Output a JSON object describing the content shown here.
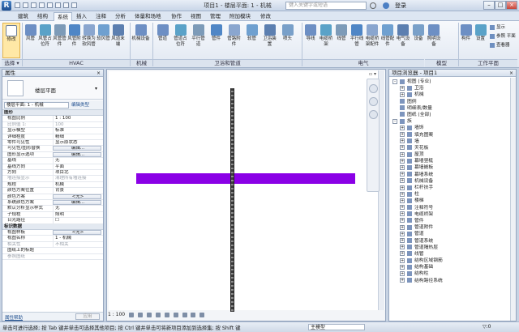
{
  "app": {
    "title": "项目1 - 楼层平面: 1 - 机械",
    "search_placeholder": "键入关键字或短语",
    "login": "登录",
    "brand_letter": "R"
  },
  "menu": {
    "tabs": [
      "建筑",
      "结构",
      "系统",
      "插入",
      "注释",
      "分析",
      "体量和场地",
      "协作",
      "视图",
      "管理",
      "附加模块",
      "修改"
    ],
    "active_index": 2
  },
  "ribbon": {
    "modify": "修改",
    "hvac_buttons": [
      "风管",
      "风管占位符",
      "风管管件",
      "风管附件",
      "转换为软风管",
      "软风管",
      "风道末端"
    ],
    "mech_buttons": [
      "机械设备"
    ],
    "plumbing_buttons": [
      "管道",
      "管道占位符",
      "平行管道",
      "管件",
      "管路附件",
      "软管",
      "卫浴装置",
      "喷头"
    ],
    "elec_buttons": [
      "导线",
      "电缆桥架",
      "线管",
      "平行线管",
      "电缆桥架配件",
      "线管配件",
      "电气设备",
      "设备",
      "照明设备"
    ],
    "workplane_buttons": [
      "构件",
      "设置"
    ],
    "workplane_small": [
      "显示",
      "参照 平面",
      "查看器"
    ],
    "panels": {
      "select": "选择 ▾",
      "hvac": "HVAC",
      "mech": "机械",
      "plumbing": "卫浴和管道",
      "elec": "电气",
      "model": "模型",
      "workplane": "工作平面"
    }
  },
  "properties": {
    "title": "属性",
    "type_name": "楼层平面",
    "selector": "楼层平面: 1 - 机械",
    "edit_type": "编辑类型",
    "groups": [
      "图形",
      "标识数据"
    ],
    "graphics_rows": [
      {
        "k": "视图比例",
        "v": "1 : 100"
      },
      {
        "k": "比例值 1:",
        "v": "100",
        "grey": true
      },
      {
        "k": "显示模型",
        "v": "标准"
      },
      {
        "k": "详细程度",
        "v": "精细"
      },
      {
        "k": "零件可见性",
        "v": "显示原状态"
      },
      {
        "k": "可见性/图形替换",
        "v": "编辑...",
        "btn": true
      },
      {
        "k": "图形显示选项",
        "v": "编辑...",
        "btn": true
      },
      {
        "k": "基线",
        "v": "无"
      },
      {
        "k": "基线方向",
        "v": "平面"
      },
      {
        "k": "方向",
        "v": "项目北"
      },
      {
        "k": "墙连接显示",
        "v": "清理所有墙连接",
        "grey": true
      },
      {
        "k": "规程",
        "v": "机械"
      },
      {
        "k": "颜色方案位置",
        "v": "背景"
      },
      {
        "k": "颜色方案",
        "v": "<无>",
        "btn": true
      },
      {
        "k": "系统颜色方案",
        "v": "编辑...",
        "btn": true
      },
      {
        "k": "默认分析显示样式",
        "v": "无"
      },
      {
        "k": "子规程",
        "v": "照明"
      },
      {
        "k": "日光路径",
        "v": "☐"
      }
    ],
    "identity_rows": [
      {
        "k": "视图样板",
        "v": "<无>",
        "btn": true
      },
      {
        "k": "视图名称",
        "v": "1 - 机械"
      },
      {
        "k": "相关性",
        "v": "不相关",
        "grey": true
      },
      {
        "k": "图纸上的标题",
        "v": ""
      },
      {
        "k": "参照图纸",
        "v": "",
        "grey": true
      }
    ],
    "help": "属性帮助",
    "apply": "应用"
  },
  "canvas": {
    "scale": "1 : 100",
    "nav_top": "▫ ▾"
  },
  "browser": {
    "title": "项目浏览器 - 项目1",
    "items": [
      {
        "t": "视图 (专业)",
        "lvl": 0,
        "exp": "-"
      },
      {
        "t": "卫浴",
        "lvl": 1,
        "exp": "+"
      },
      {
        "t": "机械",
        "lvl": 1,
        "exp": "+"
      },
      {
        "t": "图例",
        "lvl": 0,
        "exp": ""
      },
      {
        "t": "明细表/数量",
        "lvl": 0,
        "exp": ""
      },
      {
        "t": "图纸 (全部)",
        "lvl": 0,
        "exp": ""
      },
      {
        "t": "族",
        "lvl": 0,
        "exp": "-"
      },
      {
        "t": "墙饰",
        "lvl": 1,
        "exp": "+"
      },
      {
        "t": "填充图案",
        "lvl": 1,
        "exp": "+"
      },
      {
        "t": "墙",
        "lvl": 1,
        "exp": "+"
      },
      {
        "t": "天花板",
        "lvl": 1,
        "exp": "+"
      },
      {
        "t": "屋顶",
        "lvl": 1,
        "exp": "+"
      },
      {
        "t": "幕墙竖梃",
        "lvl": 1,
        "exp": "+"
      },
      {
        "t": "幕墙嵌板",
        "lvl": 1,
        "exp": "+"
      },
      {
        "t": "幕墙系统",
        "lvl": 1,
        "exp": "+"
      },
      {
        "t": "机械设备",
        "lvl": 1,
        "exp": "+"
      },
      {
        "t": "栏杆扶手",
        "lvl": 1,
        "exp": "+"
      },
      {
        "t": "柱",
        "lvl": 1,
        "exp": "+"
      },
      {
        "t": "楼梯",
        "lvl": 1,
        "exp": "+"
      },
      {
        "t": "注释符号",
        "lvl": 1,
        "exp": "+"
      },
      {
        "t": "电缆桥架",
        "lvl": 1,
        "exp": "+"
      },
      {
        "t": "管件",
        "lvl": 1,
        "exp": "+"
      },
      {
        "t": "管道附件",
        "lvl": 1,
        "exp": "+"
      },
      {
        "t": "管道",
        "lvl": 1,
        "exp": "+"
      },
      {
        "t": "管道系统",
        "lvl": 1,
        "exp": "+"
      },
      {
        "t": "管道隔热层",
        "lvl": 1,
        "exp": "+"
      },
      {
        "t": "线管",
        "lvl": 1,
        "exp": "+"
      },
      {
        "t": "结构区域钢筋",
        "lvl": 1,
        "exp": "+"
      },
      {
        "t": "结构基础",
        "lvl": 1,
        "exp": "+"
      },
      {
        "t": "结构柱",
        "lvl": 1,
        "exp": "+"
      },
      {
        "t": "结构路径系统",
        "lvl": 1,
        "exp": "+"
      }
    ]
  },
  "status": {
    "text": "单击可进行选择; 按 Tab 键并单击可选择其他项目; 按 Ctrl 键并单击可将新项目添加到选择集; 按 Shift 键",
    "model": "主模型",
    "filter": "▽:0"
  },
  "colors": {
    "duct": "#8a00e6",
    "pipe": "#3c3c3c"
  }
}
